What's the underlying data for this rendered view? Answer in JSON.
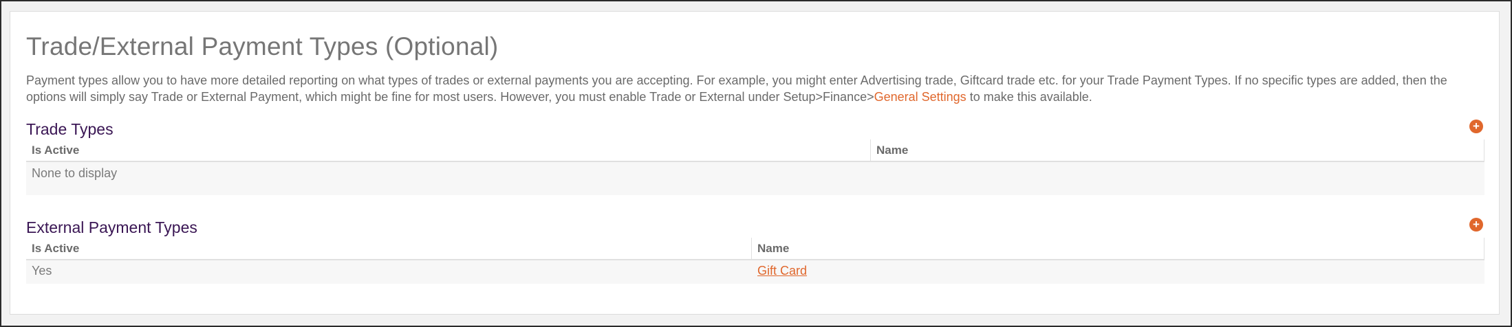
{
  "page": {
    "title": "Trade/External Payment Types (Optional)",
    "intro_text": "Payment types allow you to have more detailed reporting on what types of trades or external payments you are accepting. For example, you might enter Advertising trade, Giftcard trade etc. for your Trade Payment Types. If no specific types are added, then the options will simply say Trade or External Payment, which might be fine for most users. However, you must enable Trade or External under Setup>Finance>",
    "intro_link": "General Settings",
    "intro_suffix": " to make this available."
  },
  "trade_types": {
    "title": "Trade Types",
    "add_icon": "plus-circle-icon",
    "columns": [
      "Is Active",
      "Name"
    ],
    "empty_text": "None to display"
  },
  "external_types": {
    "title": "External Payment Types",
    "add_icon": "plus-circle-icon",
    "columns": [
      "Is Active",
      "Name"
    ],
    "rows": [
      {
        "is_active": "Yes",
        "name": "Gift Card"
      }
    ]
  },
  "colors": {
    "accent": "#e0672c",
    "section_title": "#3a1654",
    "text": "#6a6a6a"
  }
}
